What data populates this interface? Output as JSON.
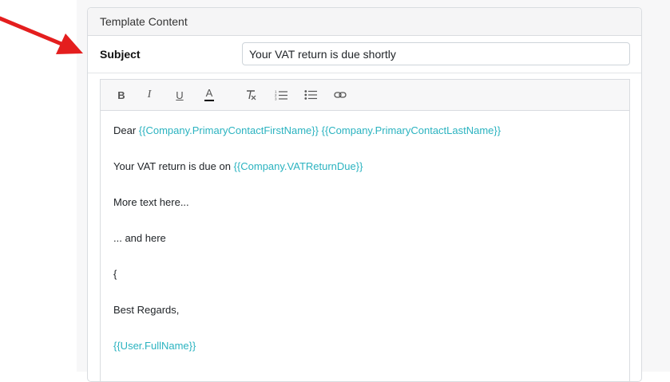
{
  "card": {
    "header_title": "Template Content"
  },
  "subject": {
    "label": "Subject",
    "value": "Your VAT return is due shortly"
  },
  "toolbar": {
    "bold_label": "B",
    "italic_label": "I",
    "underline_label": "U",
    "font_color_label": "A"
  },
  "body": {
    "line1_text": "Dear ",
    "line1_ph1": "{{Company.PrimaryContactFirstName}}",
    "line1_sep": " ",
    "line1_ph2": "{{Company.PrimaryContactLastName}}",
    "line2_text": "Your VAT return is due on ",
    "line2_ph": "{{Company.VATReturnDue}}",
    "line3_text": "More text here...",
    "line4_text": "... and here",
    "line5_text": "{",
    "line6_text": "Best Regards,",
    "line7_ph": "{{User.FullName}}"
  },
  "colors": {
    "placeholder": "#2bb3c0",
    "arrow": "#e41e1e"
  }
}
